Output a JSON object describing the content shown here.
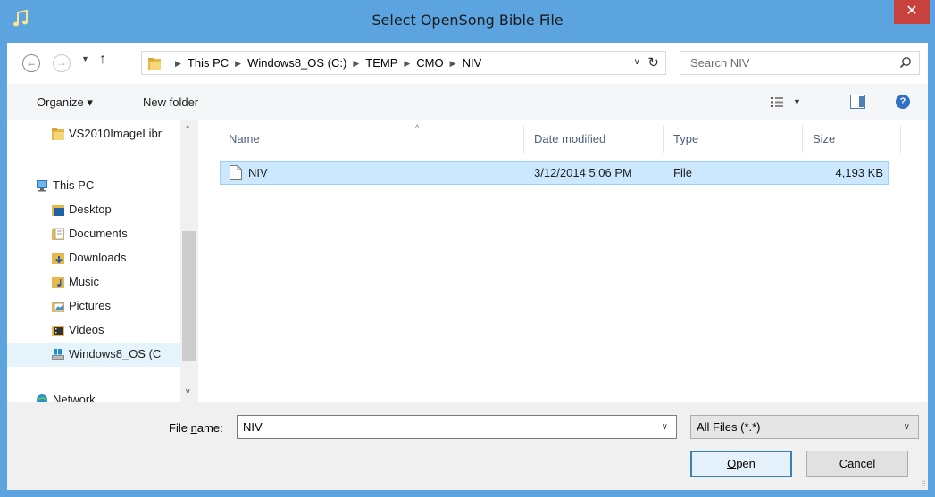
{
  "window": {
    "title": "Select OpenSong Bible File",
    "close_glyph": "✕"
  },
  "nav": {
    "back_glyph": "←",
    "forward_glyph": "→",
    "history_glyph": "▼",
    "up_glyph": "↑",
    "breadcrumbs": [
      "This PC",
      "Windows8_OS (C:)",
      "TEMP",
      "CMO",
      "NIV"
    ],
    "breadcrumb_sep": "▶",
    "refresh_glyph": "↻",
    "dropdown_glyph": "∨"
  },
  "search": {
    "placeholder": "Search NIV"
  },
  "toolbar": {
    "organize_label": "Organize ▾",
    "new_folder_label": "New folder",
    "view_dropdown_glyph": "▼",
    "help_glyph": "?"
  },
  "sidebar": {
    "items": [
      {
        "label": "VS2010ImageLibr",
        "icon": "folder-icon"
      },
      {
        "label": "This PC",
        "icon": "computer-icon"
      },
      {
        "label": "Desktop",
        "icon": "desktop-folder-icon"
      },
      {
        "label": "Documents",
        "icon": "documents-folder-icon"
      },
      {
        "label": "Downloads",
        "icon": "downloads-folder-icon"
      },
      {
        "label": "Music",
        "icon": "music-folder-icon"
      },
      {
        "label": "Pictures",
        "icon": "pictures-folder-icon"
      },
      {
        "label": "Videos",
        "icon": "videos-folder-icon"
      },
      {
        "label": "Windows8_OS (C",
        "icon": "drive-icon"
      },
      {
        "label": "Network",
        "icon": "network-icon"
      }
    ],
    "scroll_up_glyph": "^",
    "scroll_down_glyph": "v"
  },
  "files": {
    "columns": [
      "Name",
      "Date modified",
      "Type",
      "Size"
    ],
    "sort_glyph": "^",
    "rows": [
      {
        "name": "NIV",
        "date_modified": "3/12/2014 5:06 PM",
        "type": "File",
        "size": "4,193 KB"
      }
    ]
  },
  "footer": {
    "file_name_label_pre": "File ",
    "file_name_label_u": "n",
    "file_name_label_post": "ame:",
    "file_name_value": "NIV",
    "file_type_value": "All Files (*.*)",
    "dropdown_glyph": "∨",
    "open_label_u": "O",
    "open_label_rest": "pen",
    "cancel_label": "Cancel",
    "grip_glyph": "⠿"
  },
  "colors": {
    "title_bar": "#5ba4e0",
    "close_button": "#c7423c",
    "selection": "#cce8ff",
    "selection_border": "#99d1ff",
    "folder": "#e8b84a"
  }
}
